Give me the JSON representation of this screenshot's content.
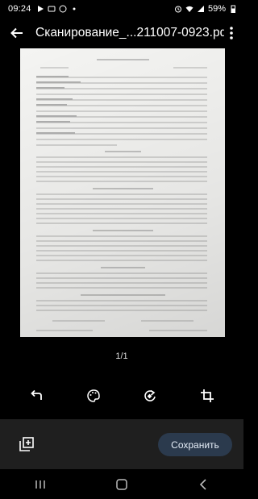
{
  "status_bar": {
    "time": "09:24",
    "battery": "59%",
    "left_icons": [
      "play-icon",
      "message-icon",
      "whatsapp-icon",
      "dot-icon"
    ],
    "right_icons": [
      "alarm-icon",
      "wifi-icon",
      "signal-icon",
      "battery-icon"
    ]
  },
  "header": {
    "title": "Сканирование_...211007-0923.pdf"
  },
  "document": {
    "heading": "Договор аренды квартиры",
    "sections": [
      "1. Предмет договора",
      "2. Права и обязанности Арендодателя",
      "3. Права и обязанности Арендатора",
      "4. Порядок расчетов",
      "5. Срок действия договора и порядок его расторжения"
    ],
    "signatures": [
      "Арендодатель",
      "Арендатор"
    ]
  },
  "page_indicator": "1/1",
  "toolbar": {
    "tools": [
      "undo-icon",
      "palette-icon",
      "rotate-icon",
      "crop-icon"
    ]
  },
  "bottom": {
    "save_label": "Сохранить"
  }
}
